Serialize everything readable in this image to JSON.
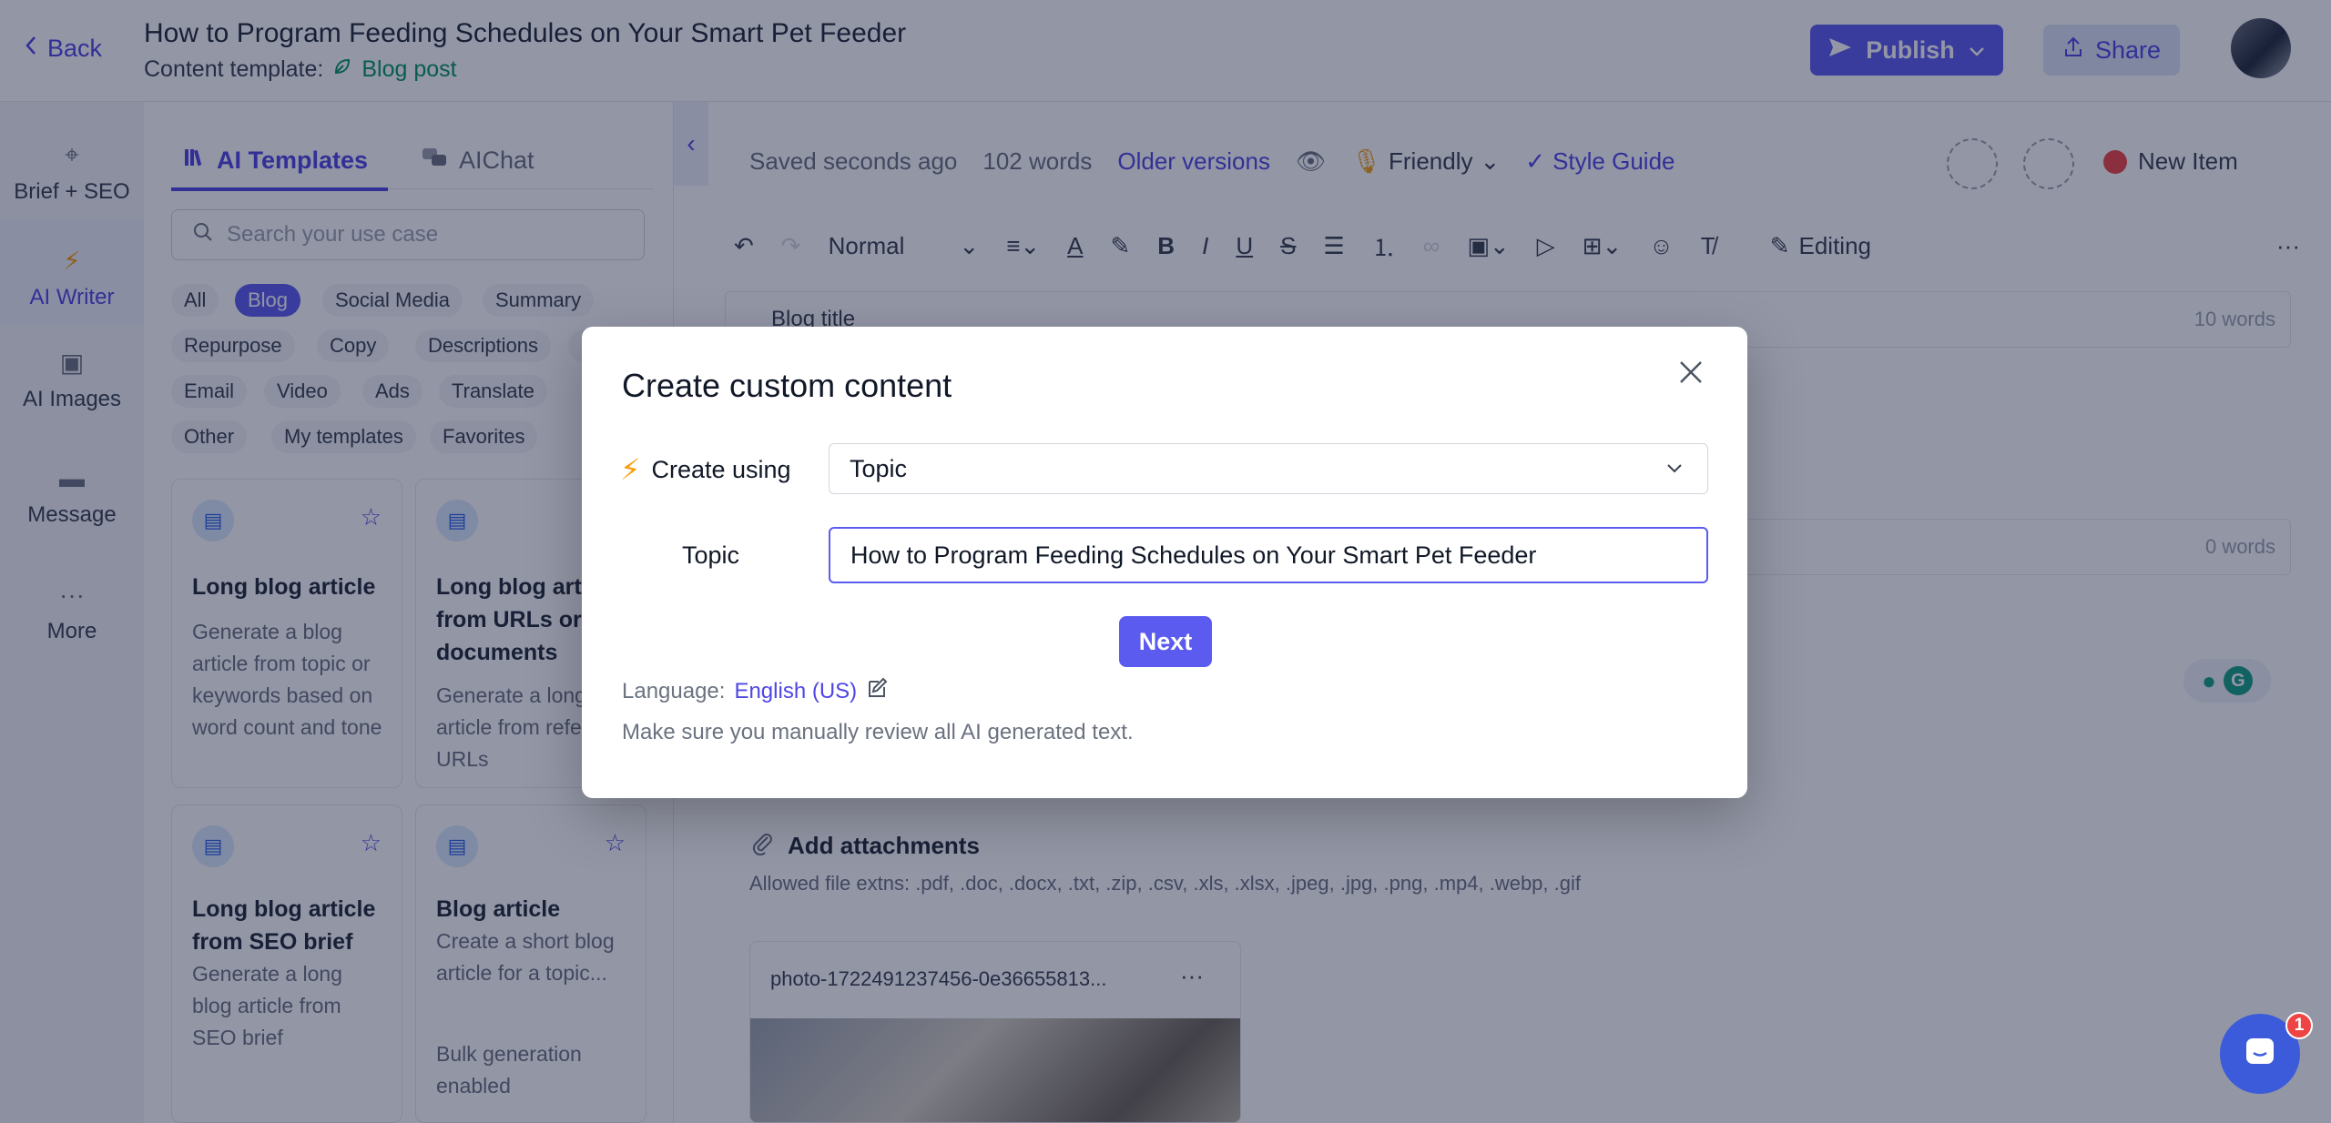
{
  "header": {
    "back_label": "Back",
    "title": "How to Program Feeding Schedules on Your Smart Pet Feeder",
    "template_prefix": "Content template:",
    "template_name": "Blog post",
    "publish_label": "Publish",
    "share_label": "Share"
  },
  "rail": {
    "items": [
      {
        "label": "Brief + SEO"
      },
      {
        "label": "AI Writer"
      },
      {
        "label": "AI Images"
      },
      {
        "label": "Message"
      },
      {
        "label": "More"
      }
    ]
  },
  "panel": {
    "tabs": [
      {
        "label": "AI Templates"
      },
      {
        "label": "AIChat"
      }
    ],
    "search_placeholder": "Search your use case",
    "chips": [
      {
        "label": "All"
      },
      {
        "label": "Blog"
      },
      {
        "label": "Social Media"
      },
      {
        "label": "Summary"
      },
      {
        "label": "Repurpose"
      },
      {
        "label": "Copy"
      },
      {
        "label": "Descriptions"
      },
      {
        "label": "S"
      },
      {
        "label": "Email"
      },
      {
        "label": "Video"
      },
      {
        "label": "Ads"
      },
      {
        "label": "Translate"
      },
      {
        "label": "Other"
      },
      {
        "label": "My templates"
      },
      {
        "label": "Favorites"
      }
    ],
    "cards": [
      {
        "title": "Long blog article",
        "desc": "Generate a blog article from topic or keywords based on word count and tone"
      },
      {
        "title": "Long blog article from URLs or documents",
        "desc": "Generate a long blog article from reference URLs"
      },
      {
        "title": "Long blog article from SEO brief",
        "desc": "Generate a long blog article from SEO brief"
      },
      {
        "title": "Blog article",
        "desc": "Create a short blog article for a topic...",
        "extra": "Bulk generation enabled"
      }
    ]
  },
  "editor": {
    "saved": "Saved seconds ago",
    "words": "102 words",
    "older_versions": "Older versions",
    "tone": "Friendly",
    "style_guide": "Style Guide",
    "new_item": "New Item",
    "format": "Normal",
    "mode": "Editing",
    "blog_title_label": "Blog title",
    "blog_title_count": "10 words",
    "field2_count": "0 words",
    "attachments_label": "Add attachments",
    "allowed_exts": "Allowed file extns: .pdf, .doc, .docx, .txt, .zip, .csv, .xls, .xlsx, .jpeg, .jpg, .png, .mp4, .webp, .gif",
    "file_name": "photo-1722491237456-0e36655813..."
  },
  "modal": {
    "title": "Create custom content",
    "create_using_label": "Create using",
    "create_using_value": "Topic",
    "topic_label": "Topic",
    "topic_value": "How to Program Feeding Schedules on Your Smart Pet Feeder",
    "next_label": "Next",
    "language_prefix": "Language:",
    "language_value": "English (US)",
    "note": "Make sure you manually review all AI generated text."
  },
  "chat": {
    "badge": "1"
  },
  "colors": {
    "accent": "#5b5bf0",
    "link": "#4f46e5",
    "success": "#059669",
    "danger": "#ef4444"
  }
}
